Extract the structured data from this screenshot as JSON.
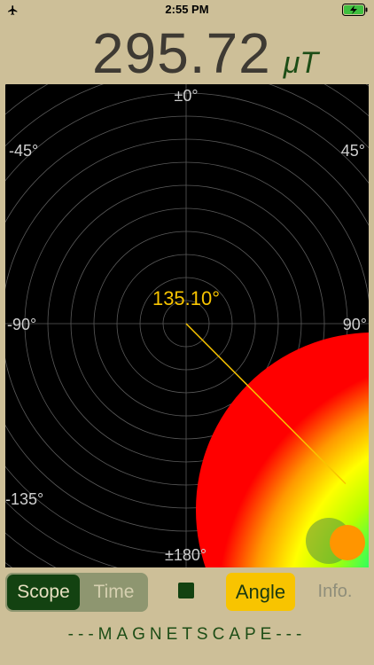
{
  "status_bar": {
    "time": "2:55 PM"
  },
  "reading": {
    "value": "295.72",
    "unit": "μT"
  },
  "scope": {
    "angle_readout": "135.10°",
    "labels": {
      "top": "±0°",
      "top_left": "-45°",
      "top_right": "45°",
      "left": "-90°",
      "right": "90°",
      "bottom_left": "-135°",
      "bottom": "±180°"
    },
    "needle_angle_deg": 135.1,
    "needle_color": "#f8c400"
  },
  "controls": {
    "mode_scope": "Scope",
    "mode_time": "Time",
    "angle_label": "Angle",
    "info_label": "Info."
  },
  "brand": "---MAGNETSCAPE---",
  "colors": {
    "background": "#cdbf98",
    "accent_green": "#134211",
    "accent_yellow": "#f8c400"
  }
}
